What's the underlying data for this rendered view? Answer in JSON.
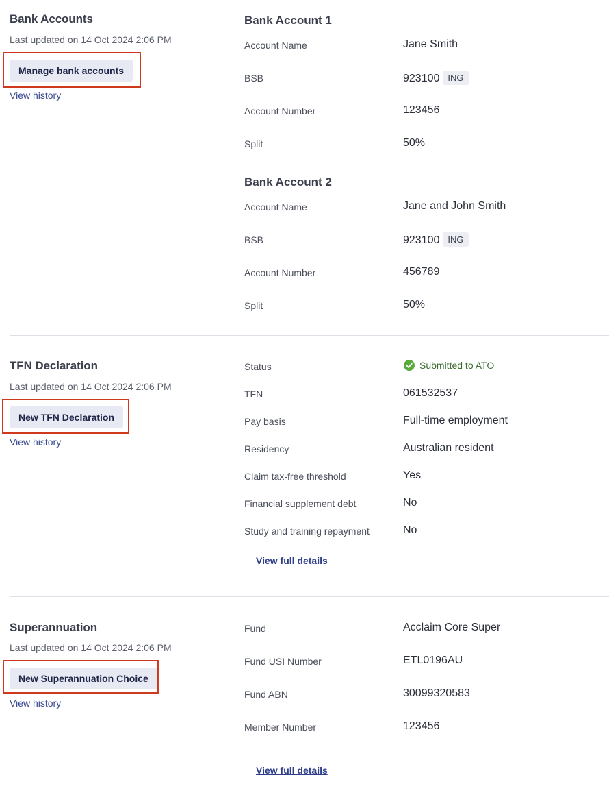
{
  "bank": {
    "title": "Bank Accounts",
    "updated": "Last updated on 14 Oct 2024 2:06 PM",
    "button": "Manage bank accounts",
    "history": "View history",
    "accounts": [
      {
        "heading": "Bank Account 1",
        "name_label": "Account Name",
        "name": "Jane Smith",
        "bsb_label": "BSB",
        "bsb": "923100",
        "bank": "ING",
        "number_label": "Account Number",
        "number": "123456",
        "split_label": "Split",
        "split": "50%"
      },
      {
        "heading": "Bank Account 2",
        "name_label": "Account Name",
        "name": "Jane and John Smith",
        "bsb_label": "BSB",
        "bsb": "923100",
        "bank": "ING",
        "number_label": "Account Number",
        "number": "456789",
        "split_label": "Split",
        "split": "50%"
      }
    ]
  },
  "tfn": {
    "title": "TFN Declaration",
    "updated": "Last updated on 14 Oct 2024 2:06 PM",
    "button": "New TFN Declaration",
    "history": "View history",
    "status_icon": "check-circle-icon",
    "status_color": "#5aaa3c",
    "rows": [
      {
        "label": "Status",
        "value": "Submitted to ATO"
      },
      {
        "label": "TFN",
        "value": "061532537"
      },
      {
        "label": "Pay basis",
        "value": "Full-time employment"
      },
      {
        "label": "Residency",
        "value": "Australian resident"
      },
      {
        "label": "Claim tax-free threshold",
        "value": "Yes"
      },
      {
        "label": "Financial supplement debt",
        "value": "No"
      },
      {
        "label": "Study and training repayment",
        "value": "No"
      }
    ],
    "full_details": "View full details"
  },
  "super": {
    "title": "Superannuation",
    "updated": "Last updated on 14 Oct 2024 2:06 PM",
    "button": "New Superannuation Choice",
    "history": "View history",
    "rows": [
      {
        "label": "Fund",
        "value": "Acclaim Core Super"
      },
      {
        "label": "Fund USI Number",
        "value": "ETL0196AU"
      },
      {
        "label": "Fund ABN",
        "value": "30099320583"
      },
      {
        "label": "Member Number",
        "value": "123456"
      }
    ],
    "full_details": "View full details"
  },
  "colors": {
    "highlight": "#cf3a1e",
    "button_bg": "#e7e9f3",
    "link": "#3b4a8f"
  }
}
